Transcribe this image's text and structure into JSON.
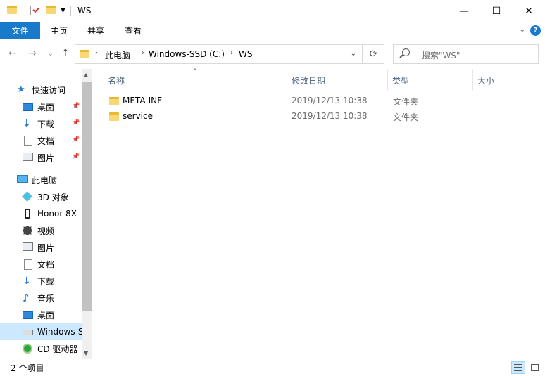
{
  "window": {
    "title": "WS",
    "minimize_glyph": "—",
    "maximize_glyph": "☐",
    "close_glyph": "✕"
  },
  "ribbon": {
    "tabs": [
      {
        "label": "文件",
        "active": true
      },
      {
        "label": "主页"
      },
      {
        "label": "共享"
      },
      {
        "label": "查看"
      }
    ],
    "help_glyph": "?"
  },
  "address": {
    "crumbs": [
      "此电脑",
      "Windows-SSD (C:)",
      "WS"
    ],
    "search_placeholder": "搜索\"WS\""
  },
  "nav": {
    "items": [
      {
        "label": "快速访问",
        "icon": "star-icon"
      },
      {
        "label": "桌面",
        "icon": "desktop-icon",
        "pinned": true
      },
      {
        "label": "下载",
        "icon": "download-icon",
        "pinned": true
      },
      {
        "label": "文档",
        "icon": "document-icon",
        "pinned": true
      },
      {
        "label": "图片",
        "icon": "pictures-icon",
        "pinned": true
      },
      {
        "label": "此电脑",
        "icon": "computer-icon"
      },
      {
        "label": "3D 对象",
        "icon": "3d-objects-icon"
      },
      {
        "label": "Honor 8X",
        "icon": "phone-icon"
      },
      {
        "label": "视频",
        "icon": "video-icon"
      },
      {
        "label": "图片",
        "icon": "pictures-icon"
      },
      {
        "label": "文档",
        "icon": "document-icon"
      },
      {
        "label": "下载",
        "icon": "download-icon"
      },
      {
        "label": "音乐",
        "icon": "music-icon"
      },
      {
        "label": "桌面",
        "icon": "desktop-icon"
      },
      {
        "label": "Windows-SSD (C:)",
        "icon": "drive-icon",
        "selected": true
      },
      {
        "label": "CD 驱动器",
        "icon": "cd-drive-icon"
      }
    ]
  },
  "columns": {
    "name": "名称",
    "date": "修改日期",
    "type": "类型",
    "size": "大小"
  },
  "files": [
    {
      "name": "META-INF",
      "date": "2019/12/13 10:38",
      "type": "文件夹"
    },
    {
      "name": "service",
      "date": "2019/12/13 10:38",
      "type": "文件夹"
    }
  ],
  "status": {
    "item_count": "2 个项目"
  },
  "colors": {
    "accent": "#1979ca",
    "selection": "#cce8ff",
    "folder": "#f8d775"
  }
}
